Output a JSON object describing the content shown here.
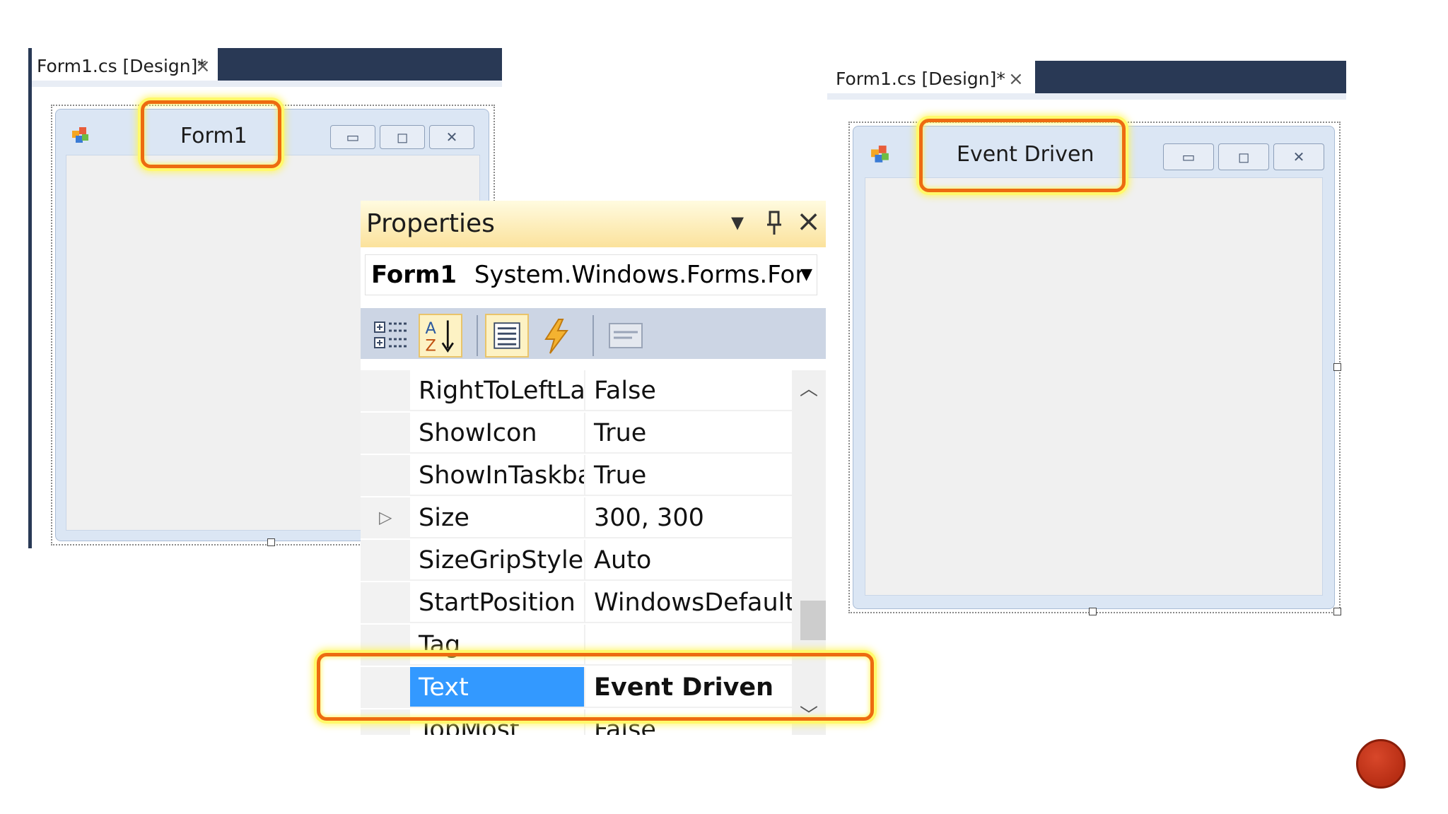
{
  "designer_left": {
    "tab_label": "Form1.cs [Design]*",
    "tab_close": "×",
    "form_caption": "Form1"
  },
  "designer_right": {
    "tab_label": "Form1.cs [Design]*",
    "tab_close": "×",
    "form_caption": "Event Driven"
  },
  "properties": {
    "title": "Properties",
    "header_icons": {
      "dropdown": "▾",
      "pin": "pin-icon",
      "close": "×"
    },
    "object_name": "Form1",
    "object_type": "System.Windows.Forms.For",
    "rows": [
      {
        "name": "RightToLeftLa",
        "value": "False"
      },
      {
        "name": "ShowIcon",
        "value": "True"
      },
      {
        "name": "ShowInTaskba",
        "value": "True"
      },
      {
        "name": "Size",
        "value": "300, 300"
      },
      {
        "name": "SizeGripStyle",
        "value": "Auto"
      },
      {
        "name": "StartPosition",
        "value": "WindowsDefault"
      },
      {
        "name": "Tag",
        "value": ""
      },
      {
        "name": "Text",
        "value": "Event Driven"
      },
      {
        "name": "TopMost",
        "value": "False"
      }
    ],
    "selected_row": "Text"
  },
  "colors": {
    "highlight_border": "#ed6b10",
    "highlight_glow": "#fff96b",
    "selection": "#3399ff",
    "tab_strip": "#293955"
  }
}
